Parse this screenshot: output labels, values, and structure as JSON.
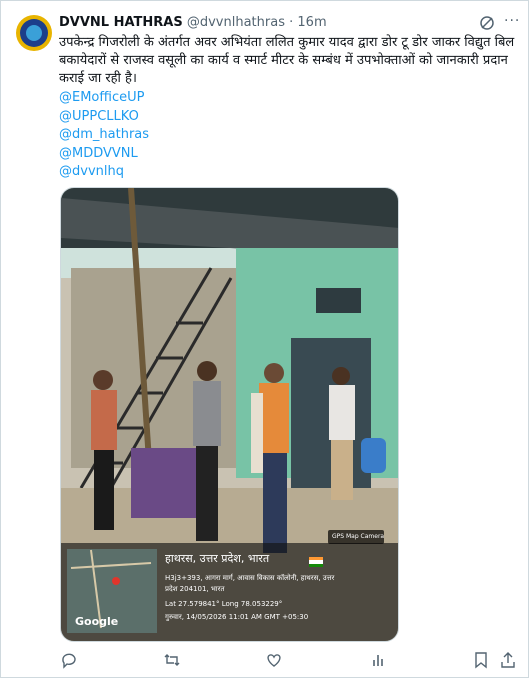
{
  "tweet": {
    "author_name": "DVVNL HATHRAS",
    "handle": "@dvvnlhathras",
    "separator": "·",
    "time": "16m",
    "text": "उपकेन्द्र गिजरोली के अंतर्गत अवर अभियंता ललित कुमार यादव द्वारा डोर टू डोर जाकर विद्युत बिल बकायेदारों से राजस्व वसूली का कार्य व स्मार्ट मीटर के सम्बंध में उपभोक्ताओं को जानकारी प्रदान कराई जा रही है।",
    "mentions": [
      "@EMofficeUP",
      "@UPPCLLKO",
      "@dm_hathras",
      "@MDDVVNL",
      "@dvvnlhq"
    ]
  },
  "photo_overlay": {
    "app_badge": "GPS Map Camera",
    "location_title": "हाथरस, उत्तर प्रदेश, भारत",
    "address_line1": "H3j3+393, आगरा मार्ग, आवास विकास कॉलोनी, हाथरस, उत्तर",
    "address_line2": "प्रदेश 204101, भारत",
    "coords": "Lat 27.579841° Long 78.053229°",
    "datetime": "गुरुवार, 14/05/2026 11:01 AM GMT +05:30",
    "map_label": "Google"
  },
  "icons": [
    "grok-icon",
    "more-icon",
    "reply-icon",
    "retweet-icon",
    "like-icon",
    "views-icon",
    "bookmark-icon",
    "share-icon"
  ],
  "colors": {
    "link": "#1d9bf0",
    "secondary": "#536471",
    "text": "#0f1419"
  }
}
